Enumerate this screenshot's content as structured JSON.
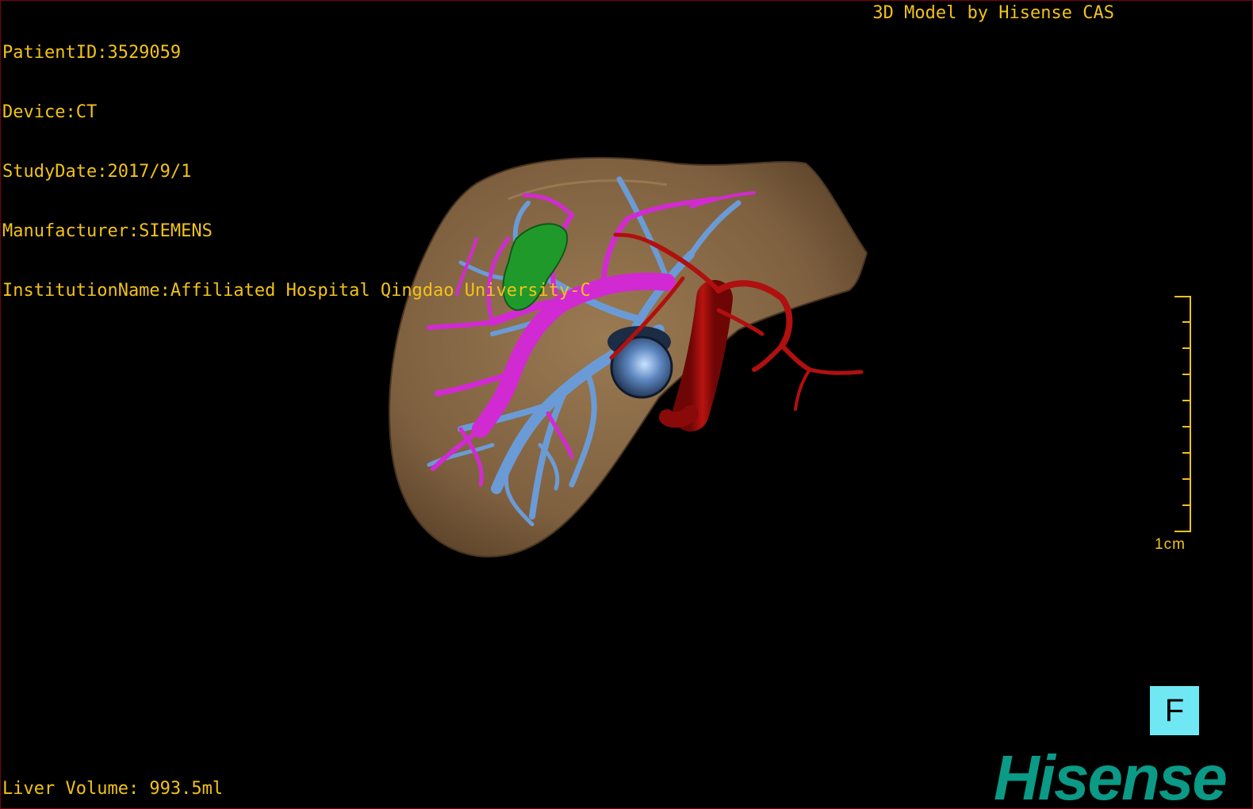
{
  "patient_info": {
    "patient_id": "PatientID:3529059",
    "device": "Device:CT",
    "study_date": "StudyDate:2017/9/1",
    "manufacturer": "Manufacturer:SIEMENS",
    "institution": "InstitutionName:Affiliated Hospital Qingdao University-C"
  },
  "branding_text": "3D Model by Hisense CAS",
  "liver_volume": "Liver Volume: 993.5ml",
  "scale_label": "1cm",
  "view_indicator": "F",
  "logo_text": "Hisense",
  "colors": {
    "overlay_text": "#f2c21a",
    "liver": "#8a6a45",
    "portal_vein": "#d22ad2",
    "hepatic_vein": "#6b9bd6",
    "artery": "#b0100f",
    "gallbladder": "#1f9a2a",
    "tumor": "#3a5a8a",
    "view_indicator_bg": "#6fe8f4",
    "logo": "#0a9a86"
  }
}
